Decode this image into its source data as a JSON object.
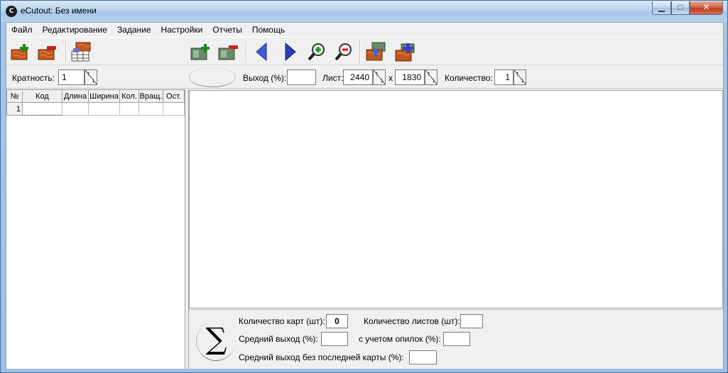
{
  "window": {
    "title": "eCutout: Без имени",
    "app_icon": "C"
  },
  "menu": [
    "Файл",
    "Редактирование",
    "Задание",
    "Настройки",
    "Отчеты",
    "Помощь"
  ],
  "toolbar": {
    "icons": [
      "add-part-icon",
      "remove-part-icon",
      "import-parts-icon",
      "add-sheet-icon",
      "remove-sheet-icon",
      "prev-arrow-icon",
      "next-arrow-icon",
      "zoom-in-icon",
      "zoom-out-icon",
      "layout-icon",
      "add-layout-icon"
    ]
  },
  "options": {
    "multiplicity_label": "Кратность:",
    "multiplicity_value": "1",
    "yield_label": "Выход (%):",
    "yield_value": "",
    "sheet_label": "Лист:",
    "sheet_width": "2440",
    "sheet_x": "x",
    "sheet_height": "1830",
    "quantity_label": "Количество:",
    "quantity_value": "1"
  },
  "table": {
    "headers": [
      "№",
      "Код",
      "Длина",
      "Ширина",
      "Кол.",
      "Вращ.",
      "Ост."
    ],
    "rows": [
      [
        "1",
        "",
        "",
        "",
        "",
        "",
        ""
      ]
    ]
  },
  "stats": {
    "cards_label": "Количество карт (шт):",
    "cards_value": "0",
    "sheets_label": "Количество листов (шт):",
    "sheets_value": "",
    "avg_yield_label": "Средний выход (%):",
    "avg_yield_value": "",
    "sawdust_label": "с учетом опилок (%):",
    "sawdust_value": "",
    "avg_no_last_label": "Средний выход без последней карты (%):",
    "avg_no_last_value": "",
    "sigma": "∑"
  }
}
